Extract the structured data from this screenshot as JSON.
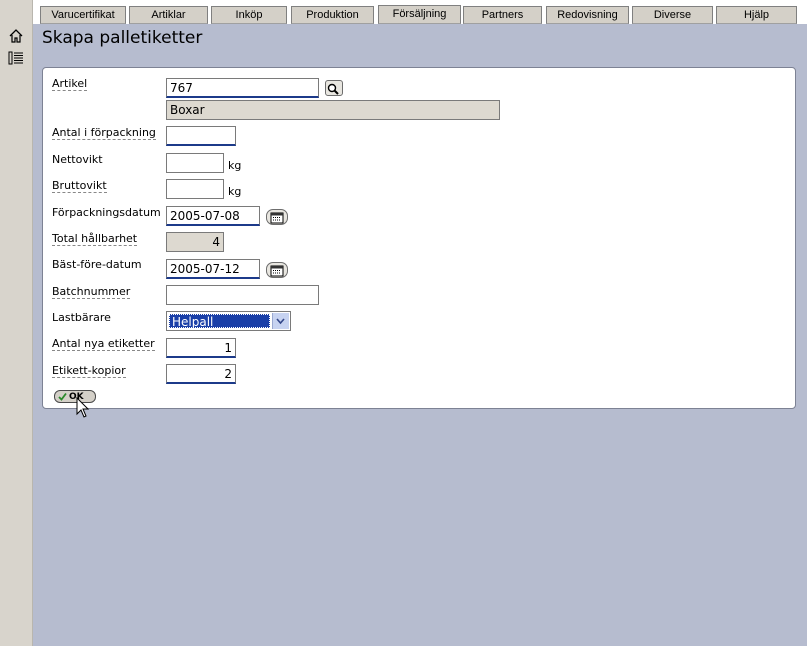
{
  "nav": {
    "tabs": [
      "Varucertifikat",
      "Artiklar",
      "Inköp",
      "Produktion",
      "Försäljning",
      "Partners",
      "Redovisning",
      "Diverse",
      "Hjälp"
    ]
  },
  "left_icons": [
    "home-icon",
    "list-icon"
  ],
  "page": {
    "title": "Skapa palletiketter"
  },
  "form": {
    "artikel": {
      "label": "Artikel",
      "value": "767",
      "name": "Boxar"
    },
    "antal_forpackning": {
      "label": "Antal i förpackning",
      "value": ""
    },
    "nettovikt": {
      "label": "Nettovikt",
      "value": "",
      "unit": "kg"
    },
    "bruttovikt": {
      "label": "Bruttovikt",
      "value": "",
      "unit": "kg"
    },
    "forpackningsdatum": {
      "label": "Förpackningsdatum",
      "value": "2005-07-08"
    },
    "total_hallbarhet": {
      "label": "Total hållbarhet",
      "value": "4"
    },
    "bast_fore": {
      "label": "Bäst-före-datum",
      "value": "2005-07-12"
    },
    "batchnummer": {
      "label": "Batchnummer",
      "value": ""
    },
    "lastbarare": {
      "label": "Lastbärare",
      "value": "Helpall"
    },
    "antal_etiketter": {
      "label": "Antal nya etiketter",
      "value": "1"
    },
    "kopior": {
      "label": "Etikett-kopior",
      "value": "2"
    },
    "ok_label": "OK"
  },
  "colors": {
    "content_bg": "#b6bccf",
    "accent": "#1c3a8a",
    "selection": "#1a3fa8"
  }
}
